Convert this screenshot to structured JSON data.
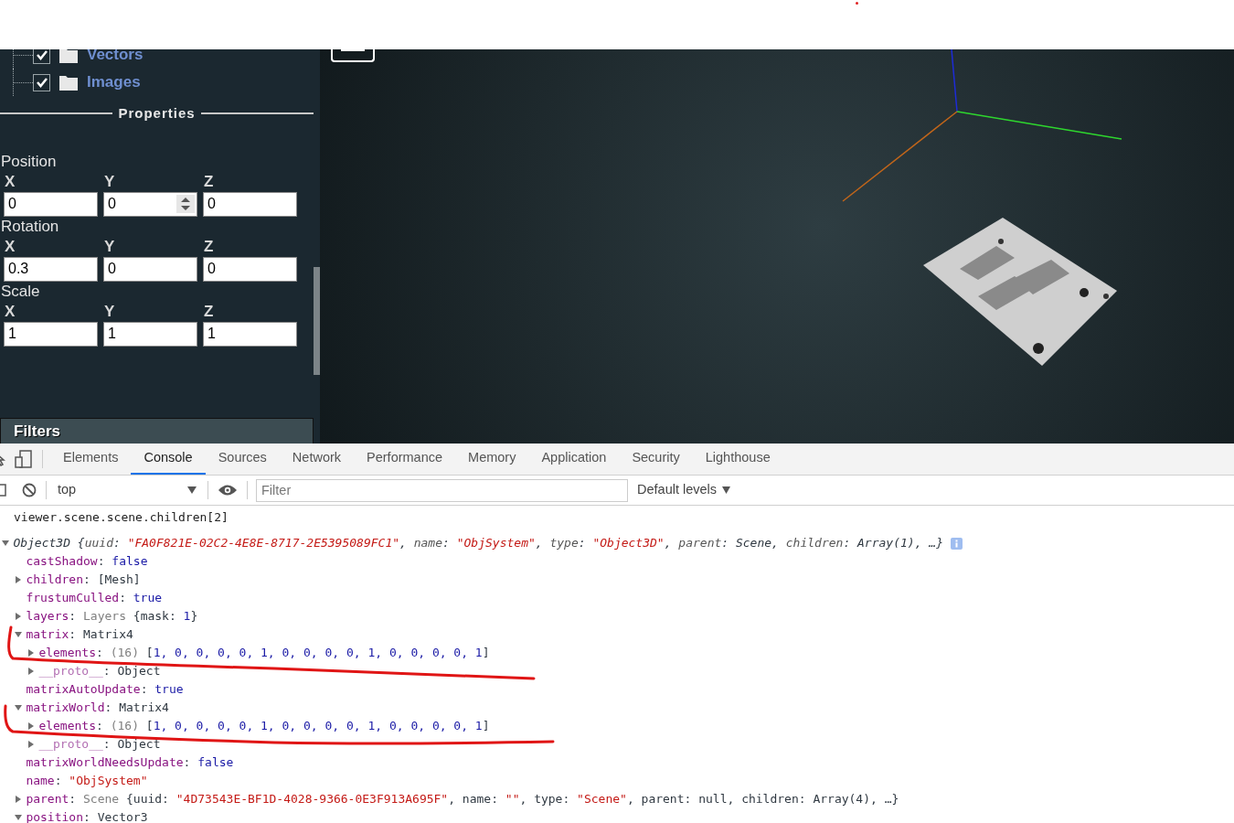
{
  "layers_tree": [
    {
      "label": "Vectors",
      "checked": true
    },
    {
      "label": "Images",
      "checked": true
    }
  ],
  "properties": {
    "title": "Properties",
    "groups": [
      {
        "label": "Position",
        "fields": [
          {
            "axis": "X",
            "value": "0",
            "hovered": false
          },
          {
            "axis": "Y",
            "value": "0",
            "hovered": true
          },
          {
            "axis": "Z",
            "value": "0",
            "hovered": false
          }
        ]
      },
      {
        "label": "Rotation",
        "fields": [
          {
            "axis": "X",
            "value": "0.3",
            "hovered": false
          },
          {
            "axis": "Y",
            "value": "0",
            "hovered": false
          },
          {
            "axis": "Z",
            "value": "0",
            "hovered": false
          }
        ]
      },
      {
        "label": "Scale",
        "fields": [
          {
            "axis": "X",
            "value": "1",
            "hovered": false
          },
          {
            "axis": "Y",
            "value": "1",
            "hovered": false
          },
          {
            "axis": "Z",
            "value": "1",
            "hovered": false
          }
        ]
      }
    ]
  },
  "filters": {
    "title": "Filters"
  },
  "devtools": {
    "tabs": [
      {
        "label": "Elements",
        "selected": false
      },
      {
        "label": "Console",
        "selected": true
      },
      {
        "label": "Sources",
        "selected": false
      },
      {
        "label": "Network",
        "selected": false
      },
      {
        "label": "Performance",
        "selected": false
      },
      {
        "label": "Memory",
        "selected": false
      },
      {
        "label": "Application",
        "selected": false
      },
      {
        "label": "Security",
        "selected": false
      },
      {
        "label": "Lighthouse",
        "selected": false
      }
    ],
    "context": "top",
    "filter": {
      "placeholder": "Filter"
    },
    "levels": "Default levels"
  },
  "console": {
    "command": "viewer.scene.scene.children[2]",
    "result": {
      "kind": "group",
      "expanded": true,
      "italic": true,
      "tokens": [
        {
          "kind": "plain",
          "text": "Object3D {"
        },
        {
          "kind": "name",
          "text": "uuid"
        },
        {
          "kind": "plain",
          "text": ": "
        },
        {
          "kind": "string",
          "text": "\"FA0F821E-02C2-4E8E-8717-2E5395089FC1\""
        },
        {
          "kind": "plain",
          "text": ", "
        },
        {
          "kind": "name",
          "text": "name"
        },
        {
          "kind": "plain",
          "text": ": "
        },
        {
          "kind": "string",
          "text": "\"ObjSystem\""
        },
        {
          "kind": "plain",
          "text": ", "
        },
        {
          "kind": "name",
          "text": "type"
        },
        {
          "kind": "plain",
          "text": ": "
        },
        {
          "kind": "string",
          "text": "\"Object3D\""
        },
        {
          "kind": "plain",
          "text": ", "
        },
        {
          "kind": "name",
          "text": "parent"
        },
        {
          "kind": "plain",
          "text": ": Scene, "
        },
        {
          "kind": "name",
          "text": "children"
        },
        {
          "kind": "plain",
          "text": ": Array(1), …}"
        }
      ],
      "children": [
        {
          "kind": "leaf",
          "italic": false,
          "tokens": [
            {
              "kind": "key",
              "text": "castShadow"
            },
            {
              "kind": "plain",
              "text": ": "
            },
            {
              "kind": "keyword",
              "text": "false"
            }
          ]
        },
        {
          "kind": "group",
          "expanded": false,
          "italic": false,
          "tokens": [
            {
              "kind": "key",
              "text": "children"
            },
            {
              "kind": "plain",
              "text": ": [Mesh]"
            }
          ]
        },
        {
          "kind": "leaf",
          "italic": false,
          "tokens": [
            {
              "kind": "key",
              "text": "frustumCulled"
            },
            {
              "kind": "plain",
              "text": ": "
            },
            {
              "kind": "keyword",
              "text": "true"
            }
          ]
        },
        {
          "kind": "group",
          "expanded": false,
          "italic": false,
          "tokens": [
            {
              "kind": "key",
              "text": "layers"
            },
            {
              "kind": "plain",
              "text": ": "
            },
            {
              "kind": "dim",
              "text": "Layers"
            },
            {
              "kind": "plain",
              "text": " {mask: "
            },
            {
              "kind": "keyword",
              "text": "1"
            },
            {
              "kind": "plain",
              "text": "}"
            }
          ]
        },
        {
          "kind": "group",
          "expanded": true,
          "italic": false,
          "tokens": [
            {
              "kind": "key",
              "text": "matrix"
            },
            {
              "kind": "plain",
              "text": ": Matrix4"
            }
          ],
          "children": [
            {
              "kind": "group",
              "expanded": false,
              "italic": false,
              "tokens": [
                {
                  "kind": "key",
                  "text": "elements"
                },
                {
                  "kind": "plain",
                  "text": ": "
                },
                {
                  "kind": "dim",
                  "text": "(16)"
                },
                {
                  "kind": "plain",
                  "text": " ["
                },
                {
                  "kind": "keyword",
                  "text": "1, 0, 0, 0, 0, 1, 0, 0, 0, 0, 1, 0, 0, 0, 0, 1"
                },
                {
                  "kind": "plain",
                  "text": "]"
                }
              ]
            },
            {
              "kind": "group",
              "expanded": false,
              "italic": false,
              "tokens": [
                {
                  "kind": "key-dim",
                  "text": "__proto__"
                },
                {
                  "kind": "plain",
                  "text": ": Object"
                }
              ]
            }
          ]
        },
        {
          "kind": "leaf",
          "italic": false,
          "tokens": [
            {
              "kind": "key",
              "text": "matrixAutoUpdate"
            },
            {
              "kind": "plain",
              "text": ": "
            },
            {
              "kind": "keyword",
              "text": "true"
            }
          ]
        },
        {
          "kind": "group",
          "expanded": true,
          "italic": false,
          "tokens": [
            {
              "kind": "key",
              "text": "matrixWorld"
            },
            {
              "kind": "plain",
              "text": ": Matrix4"
            }
          ],
          "children": [
            {
              "kind": "group",
              "expanded": false,
              "italic": false,
              "tokens": [
                {
                  "kind": "key",
                  "text": "elements"
                },
                {
                  "kind": "plain",
                  "text": ": "
                },
                {
                  "kind": "dim",
                  "text": "(16)"
                },
                {
                  "kind": "plain",
                  "text": " ["
                },
                {
                  "kind": "keyword",
                  "text": "1, 0, 0, 0, 0, 1, 0, 0, 0, 0, 1, 0, 0, 0, 0, 1"
                },
                {
                  "kind": "plain",
                  "text": "]"
                }
              ]
            },
            {
              "kind": "group",
              "expanded": false,
              "italic": false,
              "tokens": [
                {
                  "kind": "key-dim",
                  "text": "__proto__"
                },
                {
                  "kind": "plain",
                  "text": ": Object"
                }
              ]
            }
          ]
        },
        {
          "kind": "leaf",
          "italic": false,
          "tokens": [
            {
              "kind": "key",
              "text": "matrixWorldNeedsUpdate"
            },
            {
              "kind": "plain",
              "text": ": "
            },
            {
              "kind": "keyword",
              "text": "false"
            }
          ]
        },
        {
          "kind": "leaf",
          "italic": false,
          "tokens": [
            {
              "kind": "key",
              "text": "name"
            },
            {
              "kind": "plain",
              "text": ": "
            },
            {
              "kind": "string",
              "text": "\"ObjSystem\""
            }
          ]
        },
        {
          "kind": "group",
          "expanded": false,
          "italic": false,
          "tokens": [
            {
              "kind": "key",
              "text": "parent"
            },
            {
              "kind": "plain",
              "text": ": "
            },
            {
              "kind": "dim",
              "text": "Scene"
            },
            {
              "kind": "plain",
              "text": " {uuid: "
            },
            {
              "kind": "string",
              "text": "\"4D73543E-BF1D-4028-9366-0E3F913A695F\""
            },
            {
              "kind": "plain",
              "text": ", name: "
            },
            {
              "kind": "string",
              "text": "\"\""
            },
            {
              "kind": "plain",
              "text": ", type: "
            },
            {
              "kind": "string",
              "text": "\"Scene\""
            },
            {
              "kind": "plain",
              "text": ", parent: null, children: Array(4), …}"
            }
          ]
        },
        {
          "kind": "group",
          "expanded": true,
          "italic": false,
          "tokens": [
            {
              "kind": "key",
              "text": "position"
            },
            {
              "kind": "plain",
              "text": ": Vector3"
            }
          ]
        }
      ]
    }
  }
}
